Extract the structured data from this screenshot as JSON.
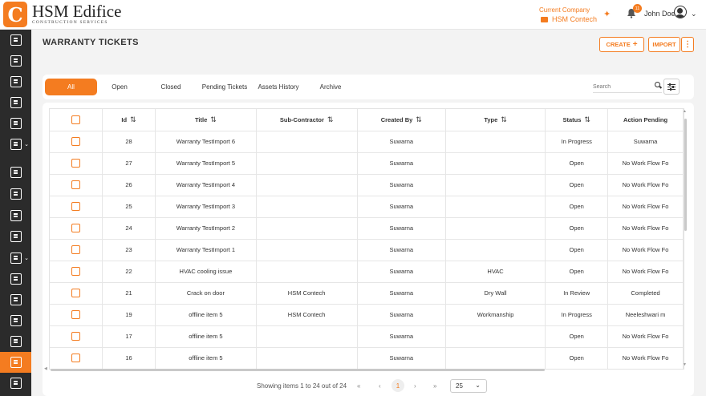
{
  "header": {
    "logo_letter": "C",
    "logo_name": "HSM Edifice",
    "logo_sub": "CONSTRUCTION SERVICES",
    "company_label": "Current Company",
    "company_name": "HSM Contech",
    "notification_count": "11",
    "user_name": "John Doe"
  },
  "page": {
    "title": "WARRANTY TICKETS",
    "create_label": "CREATE",
    "import_label": "IMPORT"
  },
  "tabs": [
    "All",
    "Open",
    "Closed",
    "Pending Tickets",
    "Assets History",
    "Archive"
  ],
  "search": {
    "placeholder": "Search"
  },
  "table": {
    "columns": [
      "Id",
      "Title",
      "Sub-Contractor",
      "Created By",
      "Type",
      "Status",
      "Action Pending"
    ],
    "rows": [
      {
        "id": "28",
        "title": "Warranty TestImport 6",
        "sub": "",
        "created_by": "Suwarna",
        "type": "",
        "status": "In Progress",
        "action": "Suwarna"
      },
      {
        "id": "27",
        "title": "Warranty TestImport 5",
        "sub": "",
        "created_by": "Suwarna",
        "type": "",
        "status": "Open",
        "action": "No Work Flow Fo"
      },
      {
        "id": "26",
        "title": "Warranty TestImport 4",
        "sub": "",
        "created_by": "Suwarna",
        "type": "",
        "status": "Open",
        "action": "No Work Flow Fo"
      },
      {
        "id": "25",
        "title": "Warranty TestImport 3",
        "sub": "",
        "created_by": "Suwarna",
        "type": "",
        "status": "Open",
        "action": "No Work Flow Fo"
      },
      {
        "id": "24",
        "title": "Warranty TestImport 2",
        "sub": "",
        "created_by": "Suwarna",
        "type": "",
        "status": "Open",
        "action": "No Work Flow Fo"
      },
      {
        "id": "23",
        "title": "Warranty TestImport 1",
        "sub": "",
        "created_by": "Suwarna",
        "type": "",
        "status": "Open",
        "action": "No Work Flow Fo"
      },
      {
        "id": "22",
        "title": "HVAC cooling issue",
        "sub": "",
        "created_by": "Suwarna",
        "type": "HVAC",
        "status": "Open",
        "action": "No Work Flow Fo"
      },
      {
        "id": "21",
        "title": "Crack on door",
        "sub": "HSM Contech",
        "created_by": "Suwarna",
        "type": "Dry Wall",
        "status": "In Review",
        "action": "Completed"
      },
      {
        "id": "19",
        "title": "offline item 5",
        "sub": "HSM Contech",
        "created_by": "Suwarna",
        "type": "Workmanship",
        "status": "In Progress",
        "action": "Neeleshwari m"
      },
      {
        "id": "17",
        "title": "offline item 5",
        "sub": "",
        "created_by": "Suwarna",
        "type": "",
        "status": "Open",
        "action": "No Work Flow Fo"
      },
      {
        "id": "16",
        "title": "offline item 5",
        "sub": "",
        "created_by": "Suwarna",
        "type": "",
        "status": "Open",
        "action": "No Work Flow Fo"
      }
    ]
  },
  "pagination": {
    "summary": "Showing items 1 to 24 out of 24",
    "current_page": "1",
    "page_size": "25"
  }
}
